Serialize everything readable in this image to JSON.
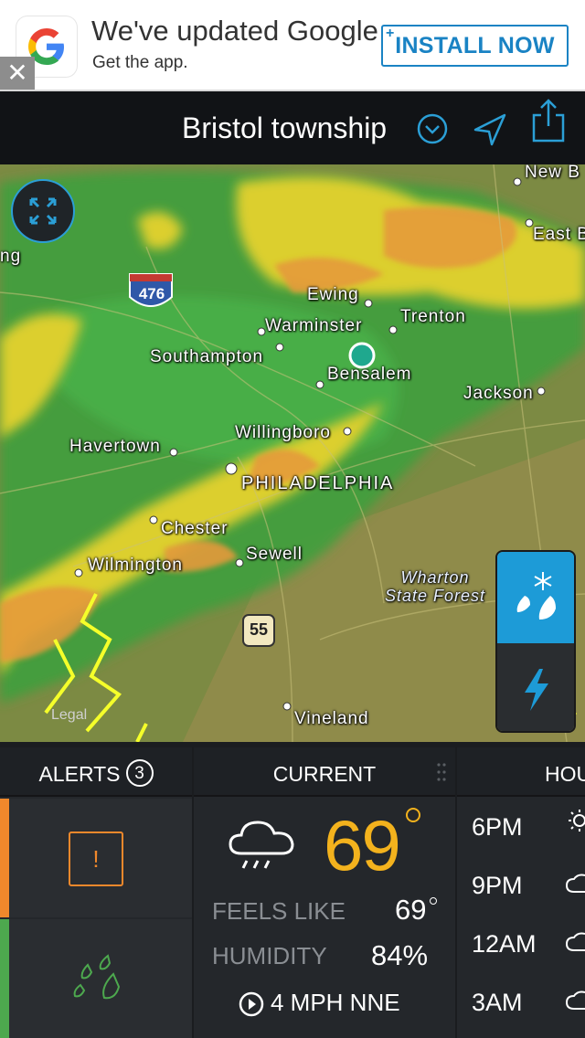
{
  "ad": {
    "title": "We've updated Google",
    "subtitle": "Get the app.",
    "install_label": "INSTALL NOW",
    "install_plus": "+",
    "close_glyph": "✕"
  },
  "header": {
    "location": "Bristol township",
    "icons": [
      "chevron-down-icon",
      "location-arrow-icon",
      "share-icon"
    ]
  },
  "map": {
    "cities": [
      {
        "name": "New B",
        "key": "new_b"
      },
      {
        "name": "East B",
        "key": "east_b"
      },
      {
        "name": "ng",
        "key": "ng"
      },
      {
        "name": "Ewing",
        "key": "ewing"
      },
      {
        "name": "Warminster",
        "key": "warminster"
      },
      {
        "name": "Trenton",
        "key": "trenton"
      },
      {
        "name": "Southampton",
        "key": "southampton"
      },
      {
        "name": "Bensalem",
        "key": "bensalem"
      },
      {
        "name": "Jackson",
        "key": "jackson"
      },
      {
        "name": "Willingboro",
        "key": "willingboro"
      },
      {
        "name": "Havertown",
        "key": "havertown"
      },
      {
        "name": "PHILADELPHIA",
        "key": "philadelphia"
      },
      {
        "name": "Chester",
        "key": "chester"
      },
      {
        "name": "Wilmington",
        "key": "wilmington"
      },
      {
        "name": "Sewell",
        "key": "sewell"
      },
      {
        "name": "Wharton State Forest",
        "key": "wharton"
      },
      {
        "name": "Vineland",
        "key": "vineland"
      }
    ],
    "highway_476": "476",
    "highway_55": "55",
    "legal": "Legal",
    "layer_buttons": [
      "precipitation-layer-button",
      "lightning-layer-button"
    ],
    "colors": {
      "radar_green": "#3fae3a",
      "radar_yellow": "#e8d52b",
      "radar_orange": "#e79a3a",
      "warning": "#f5ff2a",
      "accent": "#1d9bd7"
    }
  },
  "alerts": {
    "title": "ALERTS",
    "count": "3",
    "items": [
      {
        "icon": "exclamation-icon",
        "glyph": "!",
        "stripe": "#f0882c"
      },
      {
        "icon": "rain-drops-icon",
        "stripe": "#4da84e"
      }
    ]
  },
  "current": {
    "title": "CURRENT",
    "condition_icon": "cloud-rain-icon",
    "temperature": "69",
    "feels_like_label": "FEELS LIKE",
    "feels_like_value": "69",
    "humidity_label": "HUMIDITY",
    "humidity_value": "84%",
    "wind": "4 MPH NNE"
  },
  "hourly": {
    "title": "HOU",
    "hours": [
      {
        "time": "6PM",
        "icon": "partly-sunny-icon"
      },
      {
        "time": "9PM",
        "icon": "cloud-icon"
      },
      {
        "time": "12AM",
        "icon": "cloud-icon"
      },
      {
        "time": "3AM",
        "icon": "cloud-icon"
      }
    ]
  }
}
